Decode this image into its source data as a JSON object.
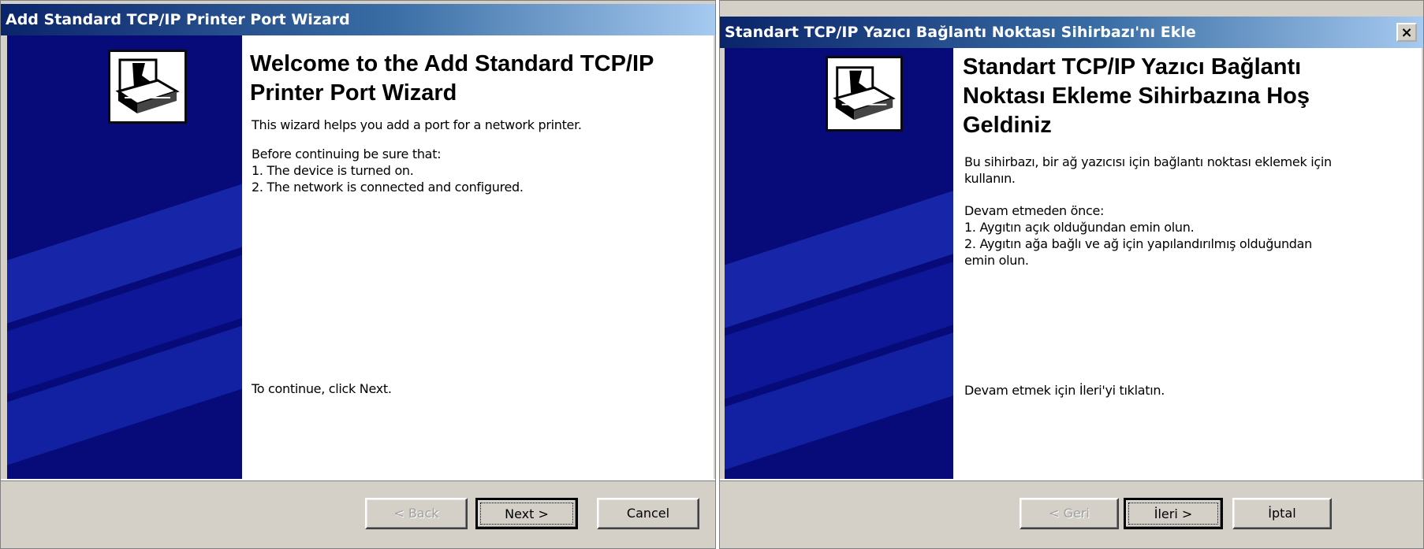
{
  "left_window": {
    "title": "Add Standard TCP/IP Printer Port Wizard",
    "heading_line1": "Welcome to the Add Standard TCP/IP",
    "heading_line2": "Printer Port Wizard",
    "intro": "This wizard helps you add a port for a network printer.",
    "before": "Before continuing be sure that:",
    "item1": "1.  The device is turned on.",
    "item2": "2.  The network is connected and configured.",
    "continue": "To continue, click Next.",
    "buttons": {
      "back": "< Back",
      "next": "Next >",
      "cancel": "Cancel"
    }
  },
  "right_window": {
    "title": "Standart TCP/IP Yazıcı Bağlantı Noktası Sihirbazı'nı Ekle",
    "close": "×",
    "heading_line1": "Standart TCP/IP Yazıcı Bağlantı",
    "heading_line2": "Noktası Ekleme Sihirbazına Hoş",
    "heading_line3": "Geldiniz",
    "intro_line1": "Bu sihirbazı, bir ağ yazıcısı için bağlantı noktası eklemek için",
    "intro_line2": "kullanın.",
    "before": "Devam etmeden önce:",
    "item1": "1.  Aygıtın açık olduğundan emin olun.",
    "item2_line1": "2.  Aygıtın ağa bağlı ve ağ için yapılandırılmış olduğundan",
    "item2_line2": "emin olun.",
    "continue": "Devam etmek için İleri'yi tıklatın.",
    "buttons": {
      "back": "< Geri",
      "next": "İleri >",
      "cancel": "İptal"
    }
  },
  "colors": {
    "titlebar_start": "#0a246a",
    "sidebar": "#070b7a",
    "dialog_face": "#d4d0c8"
  },
  "icons": [
    "printer-wizard-icon",
    "close-icon"
  ]
}
